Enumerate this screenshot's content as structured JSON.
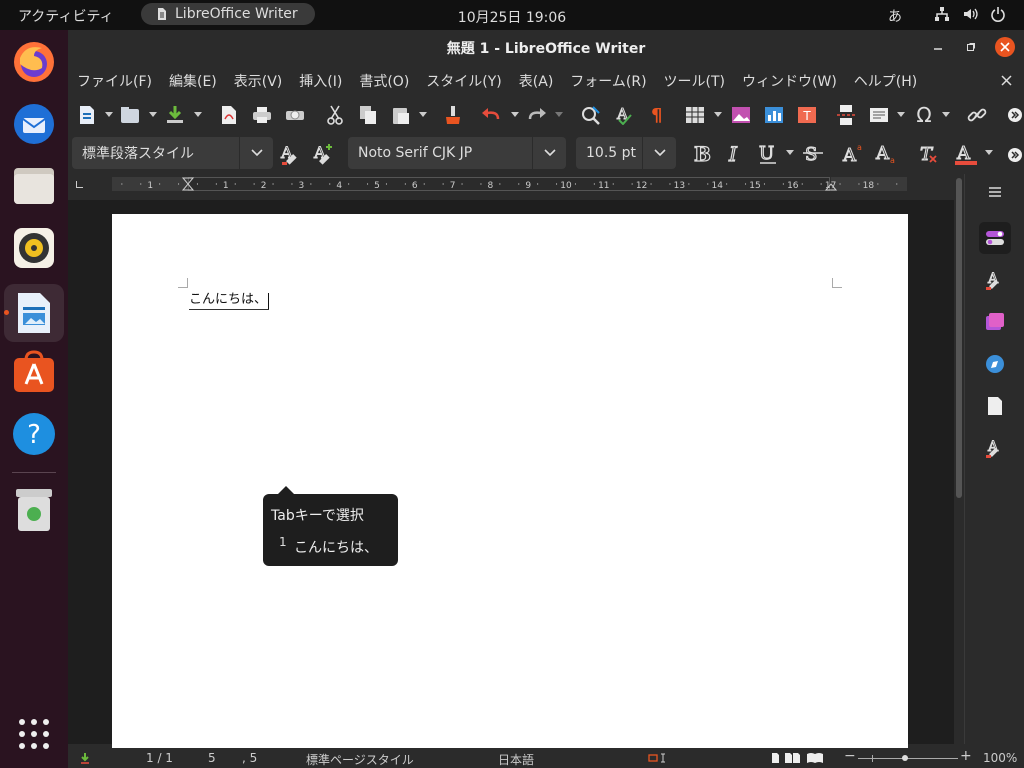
{
  "topbar": {
    "activities": "アクティビティ",
    "app_name": "LibreOffice Writer",
    "clock": "10月25日  19:06",
    "ime": "あ"
  },
  "dock": {
    "items": [
      "firefox-icon",
      "thunderbird-icon",
      "files-icon",
      "rhythmbox-icon",
      "writer-icon",
      "software-icon",
      "help-icon",
      "trash-icon",
      "apps-grid-icon"
    ]
  },
  "window": {
    "title": "無題 1 - LibreOffice Writer"
  },
  "menu": [
    "ファイル(F)",
    "編集(E)",
    "表示(V)",
    "挿入(I)",
    "書式(O)",
    "スタイル(Y)",
    "表(A)",
    "フォーム(R)",
    "ツール(T)",
    "ウィンドウ(W)",
    "ヘルプ(H)"
  ],
  "formatting": {
    "paragraph_style": "標準段落スタイル",
    "font_name": "Noto Serif CJK JP",
    "font_size": "10.5 pt"
  },
  "ruler": {
    "ticks": [
      "1",
      "1",
      "2",
      "3",
      "4",
      "5",
      "6",
      "7",
      "8",
      "9",
      "10",
      "11",
      "12",
      "13",
      "14",
      "15",
      "16",
      "17",
      "18"
    ]
  },
  "document": {
    "text": "こんにちは、"
  },
  "autocomplete": {
    "header": "Tabキーで選択",
    "number": "1",
    "suggestion": "こんにちは、"
  },
  "status": {
    "page": "1 / 1",
    "words": "5",
    "chars": ", 5",
    "page_style": "標準ページスタイル",
    "language": "日本語",
    "zoom": "100%"
  },
  "colors": {
    "accent": "#e95420",
    "undo": "#e74c3c",
    "dock_bg": "#2a1320"
  }
}
